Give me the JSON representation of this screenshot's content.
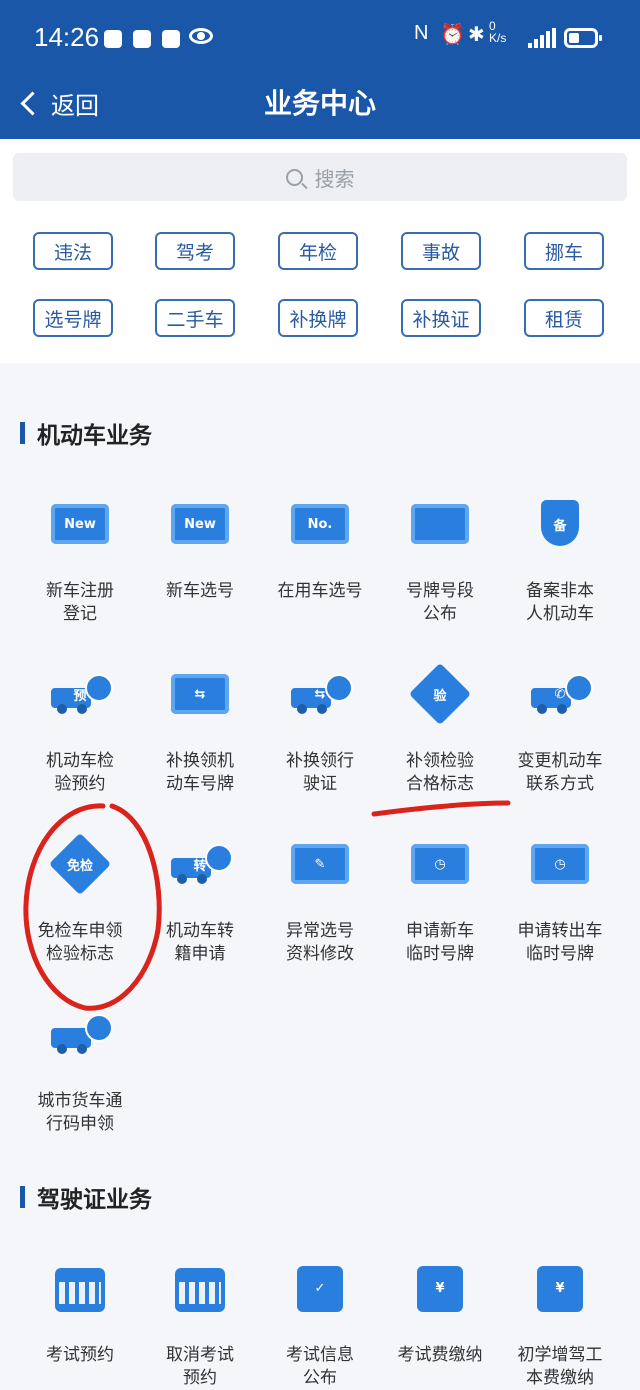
{
  "status_bar": {
    "time": "14:26",
    "net_speed": "0 K/s"
  },
  "nav": {
    "back_label": "返回",
    "title": "业务中心"
  },
  "search": {
    "placeholder": "搜索"
  },
  "quick_tags": [
    "违法",
    "驾考",
    "年检",
    "事故",
    "挪车",
    "选号牌",
    "二手车",
    "补换牌",
    "补换证",
    "租赁"
  ],
  "sections": [
    {
      "title": "机动车业务",
      "items": [
        {
          "icon": "new-car-register-icon",
          "glyph": "New",
          "line1": "新车注册",
          "line2": "登记"
        },
        {
          "icon": "new-car-plate-icon",
          "glyph": "New",
          "line1": "新车选号",
          "line2": ""
        },
        {
          "icon": "used-car-plate-icon",
          "glyph": "No.",
          "line1": "在用车选号",
          "line2": ""
        },
        {
          "icon": "plate-segment-board-icon",
          "glyph": "",
          "line1": "号牌号段",
          "line2": "公布"
        },
        {
          "icon": "record-shield-icon",
          "glyph": "备",
          "line1": "备案非本",
          "line2": "人机动车"
        },
        {
          "icon": "inspection-booking-truck-icon",
          "glyph": "预",
          "line1": "机动车检",
          "line2": "验预约"
        },
        {
          "icon": "plate-swap-icon",
          "glyph": "⇆",
          "line1": "补换领机",
          "line2": "动车号牌"
        },
        {
          "icon": "license-swap-car-icon",
          "glyph": "⇆",
          "line1": "补换领行",
          "line2": "驶证"
        },
        {
          "icon": "inspection-mark-diamond-icon",
          "glyph": "验",
          "line1": "补领检验",
          "line2": "合格标志"
        },
        {
          "icon": "change-contact-truck-icon",
          "glyph": "✆",
          "line1": "变更机动车",
          "line2": "联系方式"
        },
        {
          "icon": "exempt-inspection-diamond-icon",
          "glyph": "免检",
          "line1": "免检车申领",
          "line2": "检验标志"
        },
        {
          "icon": "transfer-truck-icon",
          "glyph": "转",
          "line1": "机动车转",
          "line2": "籍申请"
        },
        {
          "icon": "edit-plate-icon",
          "glyph": "✎",
          "line1": "异常选号",
          "line2": "资料修改"
        },
        {
          "icon": "temp-plate-clock-icon",
          "glyph": "◷",
          "line1": "申请新车",
          "line2": "临时号牌"
        },
        {
          "icon": "transfer-out-temp-plate-icon",
          "glyph": "◷",
          "line1": "申请转出车",
          "line2": "临时号牌"
        },
        {
          "icon": "city-truck-pass-icon",
          "glyph": "",
          "line1": "城市货车通",
          "line2": "行码申领"
        }
      ]
    },
    {
      "title": "驾驶证业务",
      "items": [
        {
          "icon": "exam-booking-calendar-icon",
          "glyph": "",
          "line1": "考试预约",
          "line2": ""
        },
        {
          "icon": "cancel-exam-calendar-icon",
          "glyph": "",
          "line1": "取消考试",
          "line2": "预约"
        },
        {
          "icon": "exam-info-board-icon",
          "glyph": "✓",
          "line1": "考试信息",
          "line2": "公布"
        },
        {
          "icon": "exam-fee-receipt-icon",
          "glyph": "¥",
          "line1": "考试费缴纳",
          "line2": ""
        },
        {
          "icon": "learner-fee-icon",
          "glyph": "¥",
          "line1": "初学增驾工",
          "line2": "本费缴纳"
        }
      ]
    }
  ],
  "colors": {
    "header": "#1a57a9",
    "icon_blue": "#2a7fde",
    "annotation_red": "#d9231c"
  }
}
